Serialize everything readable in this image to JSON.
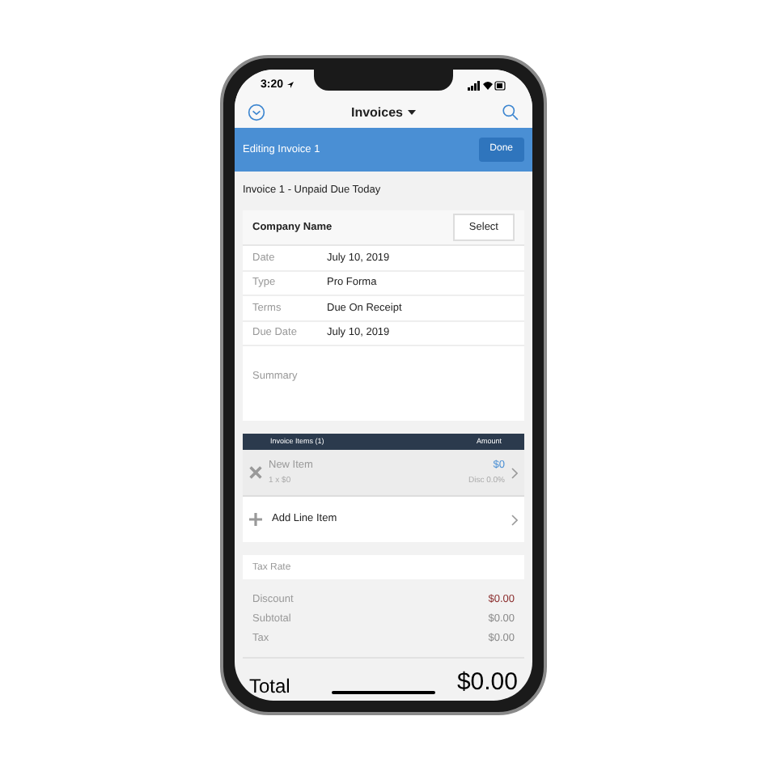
{
  "status_bar": {
    "time": "3:20"
  },
  "nav_bar": {
    "title": "Invoices"
  },
  "edit_bar": {
    "title": "Editing Invoice 1",
    "button": "Done"
  },
  "invoice_heading": "Invoice 1 - Unpaid Due Today",
  "company": {
    "label": "Company Name",
    "button": "Select"
  },
  "fields": [
    {
      "label": "Date",
      "value": "July 10, 2019"
    },
    {
      "label": "Type",
      "value": "Pro Forma"
    },
    {
      "label": "Terms",
      "value": "Due On Receipt"
    },
    {
      "label": "Due Date",
      "value": "July 10, 2019"
    }
  ],
  "summary": {
    "label": "Summary"
  },
  "items_table": {
    "columns": [
      "Invoice Items (1)",
      "Amount"
    ],
    "rows": [
      {
        "name": "New Item",
        "detail": "1 x $0",
        "amount": "$0",
        "discount": "Disc 0.0%"
      }
    ],
    "add_label": "Add Line Item"
  },
  "tax_rate": {
    "placeholder": "Tax Rate"
  },
  "totals": [
    {
      "label": "Discount",
      "value": "$0.00",
      "color": "#8b2e2e"
    },
    {
      "label": "Subtotal",
      "value": "$0.00",
      "color": "#8a8a8a"
    },
    {
      "label": "Tax",
      "value": "$0.00",
      "color": "#8a8a8a"
    }
  ],
  "total": {
    "label": "Total",
    "value": "$0.00"
  }
}
